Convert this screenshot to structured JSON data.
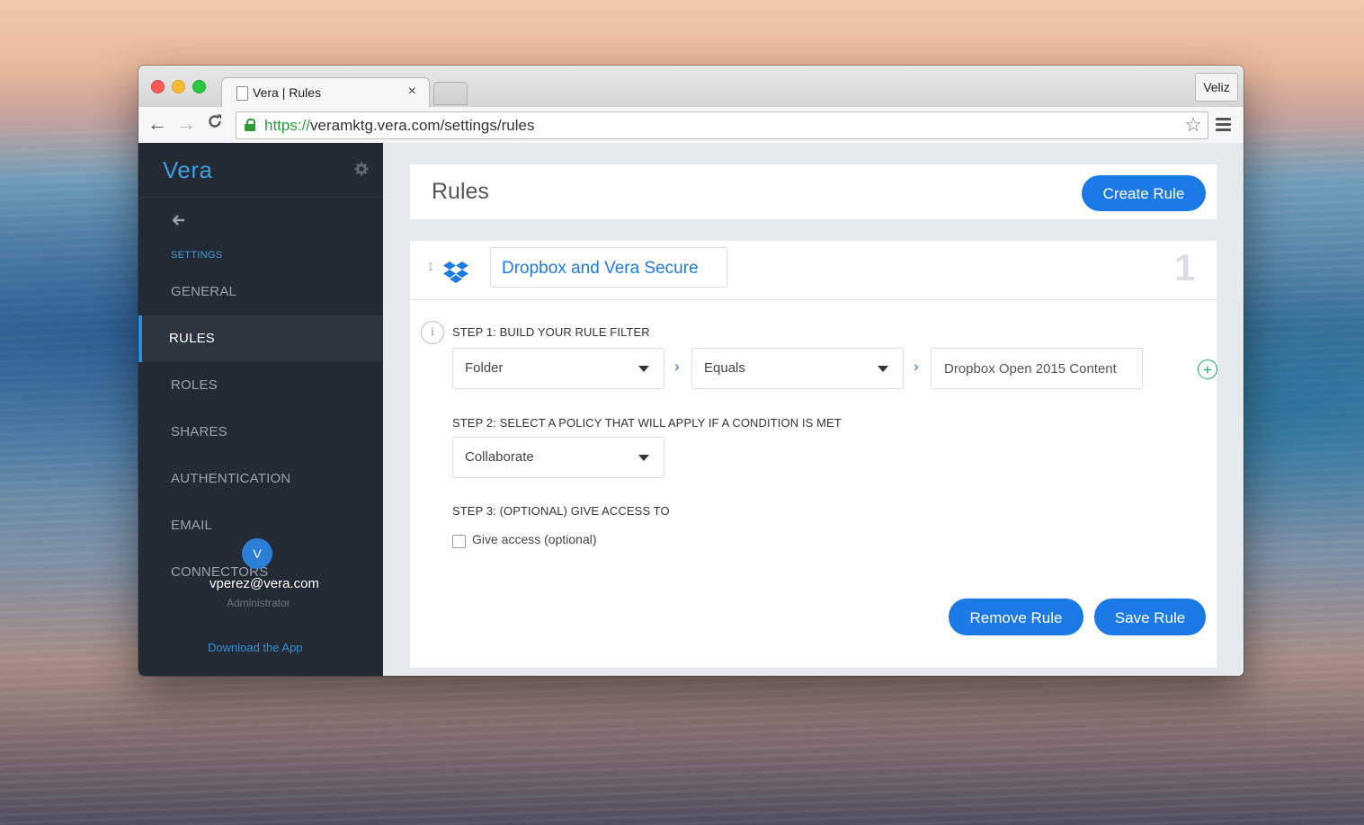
{
  "browser": {
    "tab_title": "Vera | Rules",
    "tab_close": "×",
    "profile": "Veliz",
    "url_scheme": "https://",
    "url_rest": "veramktg.vera.com/settings/rules"
  },
  "sidebar": {
    "brand": "Vera",
    "section_heading": "SETTINGS",
    "items": [
      {
        "label": "GENERAL"
      },
      {
        "label": "RULES"
      },
      {
        "label": "ROLES"
      },
      {
        "label": "SHARES"
      },
      {
        "label": "AUTHENTICATION"
      },
      {
        "label": "EMAIL"
      },
      {
        "label": "CONNECTORS"
      }
    ],
    "active_item": "RULES",
    "user": {
      "avatar_initial": "V",
      "email": "vperez@vera.com",
      "role": "Administrator"
    },
    "download_link": "Download the App"
  },
  "header": {
    "title": "Rules",
    "create_button": "Create Rule"
  },
  "rule": {
    "name": "Dropbox and Vera Secure",
    "number": "1",
    "step1": {
      "label": "STEP 1: BUILD YOUR RULE FILTER",
      "field_select": "Folder",
      "operator_select": "Equals",
      "value": "Dropbox Open 2015 Content"
    },
    "step2": {
      "label": "STEP 2: SELECT A POLICY THAT WILL APPLY IF A CONDITION IS MET",
      "policy_select": "Collaborate"
    },
    "step3": {
      "label": "STEP 3: (OPTIONAL) GIVE ACCESS TO",
      "checkbox_label": "Give access (optional)",
      "checked": false
    },
    "remove_button": "Remove Rule",
    "save_button": "Save Rule"
  },
  "icons": {
    "info": "i",
    "arrow": "›",
    "plus": "+",
    "back": "←",
    "forward": "→",
    "reload": "C",
    "star": "☆",
    "gear": "✱",
    "drag": "↕"
  },
  "colors": {
    "accent": "#1b7ae6",
    "sidebar_bg": "#232a33",
    "add_green": "#19a56b"
  }
}
